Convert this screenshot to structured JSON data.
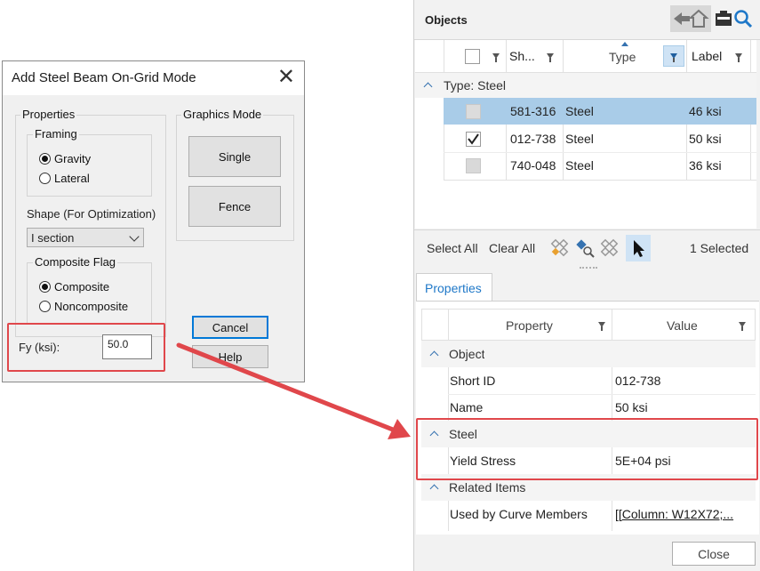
{
  "dialog": {
    "title": "Add Steel Beam On-Grid Mode",
    "properties_label": "Properties",
    "framing_label": "Framing",
    "gravity_label": "Gravity",
    "lateral_label": "Lateral",
    "shape_label": "Shape (For Optimization)",
    "shape_value": "I section",
    "composite_flag_label": "Composite Flag",
    "composite_label": "Composite",
    "noncomposite_label": "Noncomposite",
    "fy_label": "Fy (ksi):",
    "fy_value": "50.0",
    "graphics_mode_label": "Graphics Mode",
    "single_label": "Single",
    "fence_label": "Fence",
    "cancel_label": "Cancel",
    "help_label": "Help",
    "framing_selected": "Gravity",
    "composite_selected": "Composite"
  },
  "objects": {
    "title": "Objects",
    "columns": [
      "Sh...",
      "Type",
      "Label"
    ],
    "group_label": "Type: Steel",
    "rows": [
      {
        "short": "581-316",
        "type": "Steel",
        "label": "46 ksi",
        "checked": false,
        "selected": true
      },
      {
        "short": "012-738",
        "type": "Steel",
        "label": "50 ksi",
        "checked": true,
        "selected": false
      },
      {
        "short": "740-048",
        "type": "Steel",
        "label": "36 ksi",
        "checked": false,
        "selected": false
      }
    ],
    "select_all_label": "Select All",
    "clear_all_label": "Clear All",
    "selected_count": "1 Selected"
  },
  "properties": {
    "tab_label": "Properties",
    "col_property": "Property",
    "col_value": "Value",
    "object_group": "Object",
    "short_id_label": "Short ID",
    "short_id_value": "012-738",
    "name_label": "Name",
    "name_value": "50 ksi",
    "steel_group": "Steel",
    "yield_stress_label": "Yield Stress",
    "yield_stress_value": "5E+04 psi",
    "related_group": "Related Items",
    "used_by_label": "Used by Curve Members",
    "used_by_value": "[[Column: W12X72;..."
  },
  "close_label": "Close",
  "colors": {
    "highlight_red": "#e0474b",
    "selected_row": "#a9cce8",
    "accent_blue": "#0078d7",
    "expander_blue": "#3572b0"
  },
  "icons": [
    "close-icon",
    "back-arrow-icon",
    "home-icon",
    "folder-icon",
    "search-icon",
    "sort-up-icon",
    "filter-icon",
    "expand-chevron-icon",
    "checkmark-icon",
    "select-nodes-icon",
    "find-nodes-icon",
    "deselect-nodes-icon",
    "pointer-icon",
    "arrow-connector-icon"
  ]
}
